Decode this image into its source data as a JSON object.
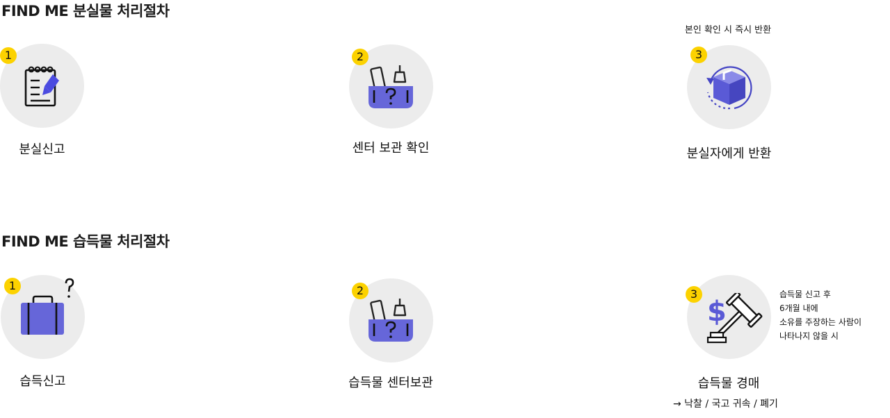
{
  "lost_section": {
    "title": "FIND ME 분실물 처리절차",
    "steps": [
      {
        "number": "1",
        "label": "분실신고",
        "icon": "notepad-pen-icon"
      },
      {
        "number": "2",
        "label": "센터 보관 확인",
        "icon": "storage-box-icon"
      },
      {
        "number": "3",
        "label": "분실자에게 반환",
        "icon": "return-package-icon",
        "note": "본인 확인 시 즉시 반환"
      }
    ]
  },
  "found_section": {
    "title": "FIND ME 습득물 처리절차",
    "steps": [
      {
        "number": "1",
        "label": "습득신고",
        "icon": "briefcase-question-icon"
      },
      {
        "number": "2",
        "label": "습득물 센터보관",
        "icon": "storage-box-icon"
      },
      {
        "number": "3",
        "label": "습득물 경매",
        "icon": "auction-gavel-icon",
        "note_lines": [
          "습득물 신고 후",
          "6개월 내에",
          "소유를 주장하는 사람이",
          "나타나지 않을 시"
        ],
        "sub_label": "→ 낙찰 / 국고 귀속 / 폐기"
      }
    ]
  },
  "colors": {
    "accent": "#5a5ad6",
    "badge": "#fcd200",
    "circle": "#ececec"
  }
}
